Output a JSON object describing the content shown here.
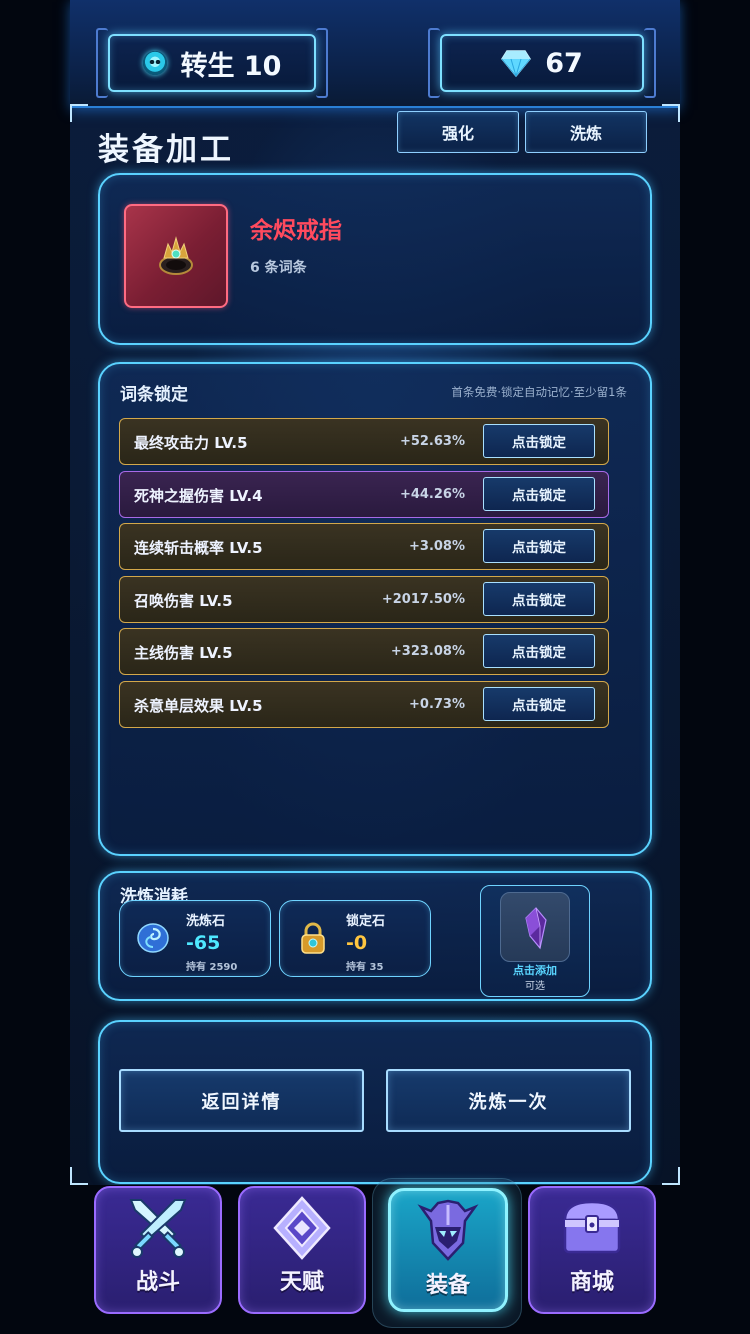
{
  "resources": {
    "rebirth_label": "转生 10",
    "gems": "67",
    "rebirth_icon": "skull-icon",
    "gem_icon": "diamond-icon"
  },
  "header": {
    "title": "装备加工",
    "tabs": [
      {
        "label": "强化"
      },
      {
        "label": "洗炼"
      }
    ]
  },
  "item": {
    "name": "余烬戒指",
    "affix_count": "6 条词条",
    "icon": "ring-icon",
    "name_color": "#ff4a5e"
  },
  "lock_section": {
    "title": "词条锁定",
    "hint": "首条免费·锁定自动记忆·至少留1条",
    "affixes": [
      {
        "name": "最终攻击力 LV.5",
        "value": "+52.63%",
        "button": "点击锁定",
        "rarity": "gold"
      },
      {
        "name": "死神之握伤害 LV.4",
        "value": "+44.26%",
        "button": "点击锁定",
        "rarity": "purple"
      },
      {
        "name": "连续斩击概率 LV.5",
        "value": "+3.08%",
        "button": "点击锁定",
        "rarity": "gold"
      },
      {
        "name": "召唤伤害 LV.5",
        "value": "+2017.50%",
        "button": "点击锁定",
        "rarity": "gold"
      },
      {
        "name": "主线伤害 LV.5",
        "value": "+323.08%",
        "button": "点击锁定",
        "rarity": "gold"
      },
      {
        "name": "杀意单层效果 LV.5",
        "value": "+0.73%",
        "button": "点击锁定",
        "rarity": "gold"
      }
    ]
  },
  "cost_section": {
    "title": "洗炼消耗",
    "stones": [
      {
        "name": "洗炼石",
        "cost": "-65",
        "held": "持有 2590",
        "icon": "refine-stone-icon"
      },
      {
        "name": "锁定石",
        "cost": "-0",
        "held": "持有 35",
        "icon": "lock-stone-icon"
      }
    ],
    "optional_slot": {
      "label": "点击添加",
      "sub": "可选",
      "icon": "crystal-icon"
    }
  },
  "actions": {
    "back": "返回详情",
    "refine_once": "洗炼一次"
  },
  "nav": [
    {
      "label": "战斗",
      "icon": "crossed-swords-icon"
    },
    {
      "label": "天赋",
      "icon": "talent-diamond-icon"
    },
    {
      "label": "装备",
      "icon": "helmet-icon",
      "active": true
    },
    {
      "label": "商城",
      "icon": "treasure-chest-icon"
    }
  ]
}
